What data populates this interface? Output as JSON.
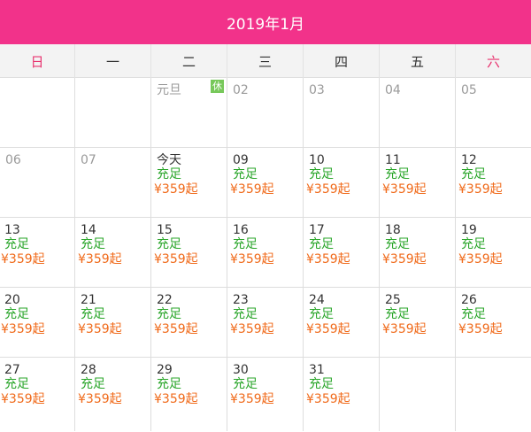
{
  "header": {
    "title": "2019年1月"
  },
  "weekdays": [
    "日",
    "一",
    "二",
    "三",
    "四",
    "五",
    "六"
  ],
  "weeks": [
    [
      {
        "day": "",
        "muted": true
      },
      {
        "day": "",
        "muted": true
      },
      {
        "day": "元旦",
        "muted": true,
        "badge": "休"
      },
      {
        "day": "02",
        "muted": true
      },
      {
        "day": "03",
        "muted": true
      },
      {
        "day": "04",
        "muted": true
      },
      {
        "day": "05",
        "muted": true
      }
    ],
    [
      {
        "day": "06",
        "muted": true
      },
      {
        "day": "07",
        "muted": true
      },
      {
        "day": "今天",
        "status": "充足",
        "price": "¥359起"
      },
      {
        "day": "09",
        "status": "充足",
        "price": "¥359起"
      },
      {
        "day": "10",
        "status": "充足",
        "price": "¥359起"
      },
      {
        "day": "11",
        "status": "充足",
        "price": "¥359起"
      },
      {
        "day": "12",
        "status": "充足",
        "price": "¥359起"
      }
    ],
    [
      {
        "day": "13",
        "status": "充足",
        "price": "¥359起"
      },
      {
        "day": "14",
        "status": "充足",
        "price": "¥359起"
      },
      {
        "day": "15",
        "status": "充足",
        "price": "¥359起"
      },
      {
        "day": "16",
        "status": "充足",
        "price": "¥359起"
      },
      {
        "day": "17",
        "status": "充足",
        "price": "¥359起"
      },
      {
        "day": "18",
        "status": "充足",
        "price": "¥359起"
      },
      {
        "day": "19",
        "status": "充足",
        "price": "¥359起"
      }
    ],
    [
      {
        "day": "20",
        "status": "充足",
        "price": "¥359起"
      },
      {
        "day": "21",
        "status": "充足",
        "price": "¥359起"
      },
      {
        "day": "22",
        "status": "充足",
        "price": "¥359起"
      },
      {
        "day": "23",
        "status": "充足",
        "price": "¥359起"
      },
      {
        "day": "24",
        "status": "充足",
        "price": "¥359起"
      },
      {
        "day": "25",
        "status": "充足",
        "price": "¥359起"
      },
      {
        "day": "26",
        "status": "充足",
        "price": "¥359起"
      }
    ],
    [
      {
        "day": "27",
        "status": "充足",
        "price": "¥359起"
      },
      {
        "day": "28",
        "status": "充足",
        "price": "¥359起"
      },
      {
        "day": "29",
        "status": "充足",
        "price": "¥359起"
      },
      {
        "day": "30",
        "status": "充足",
        "price": "¥359起"
      },
      {
        "day": "31",
        "status": "充足",
        "price": "¥359起"
      },
      {
        "day": ""
      },
      {
        "day": ""
      }
    ]
  ],
  "colors": {
    "header_bg": "#f2328a",
    "weekend": "#e8336f",
    "status": "#2aa62a",
    "price": "#f06a1a",
    "badge_bg": "#77c85a"
  }
}
